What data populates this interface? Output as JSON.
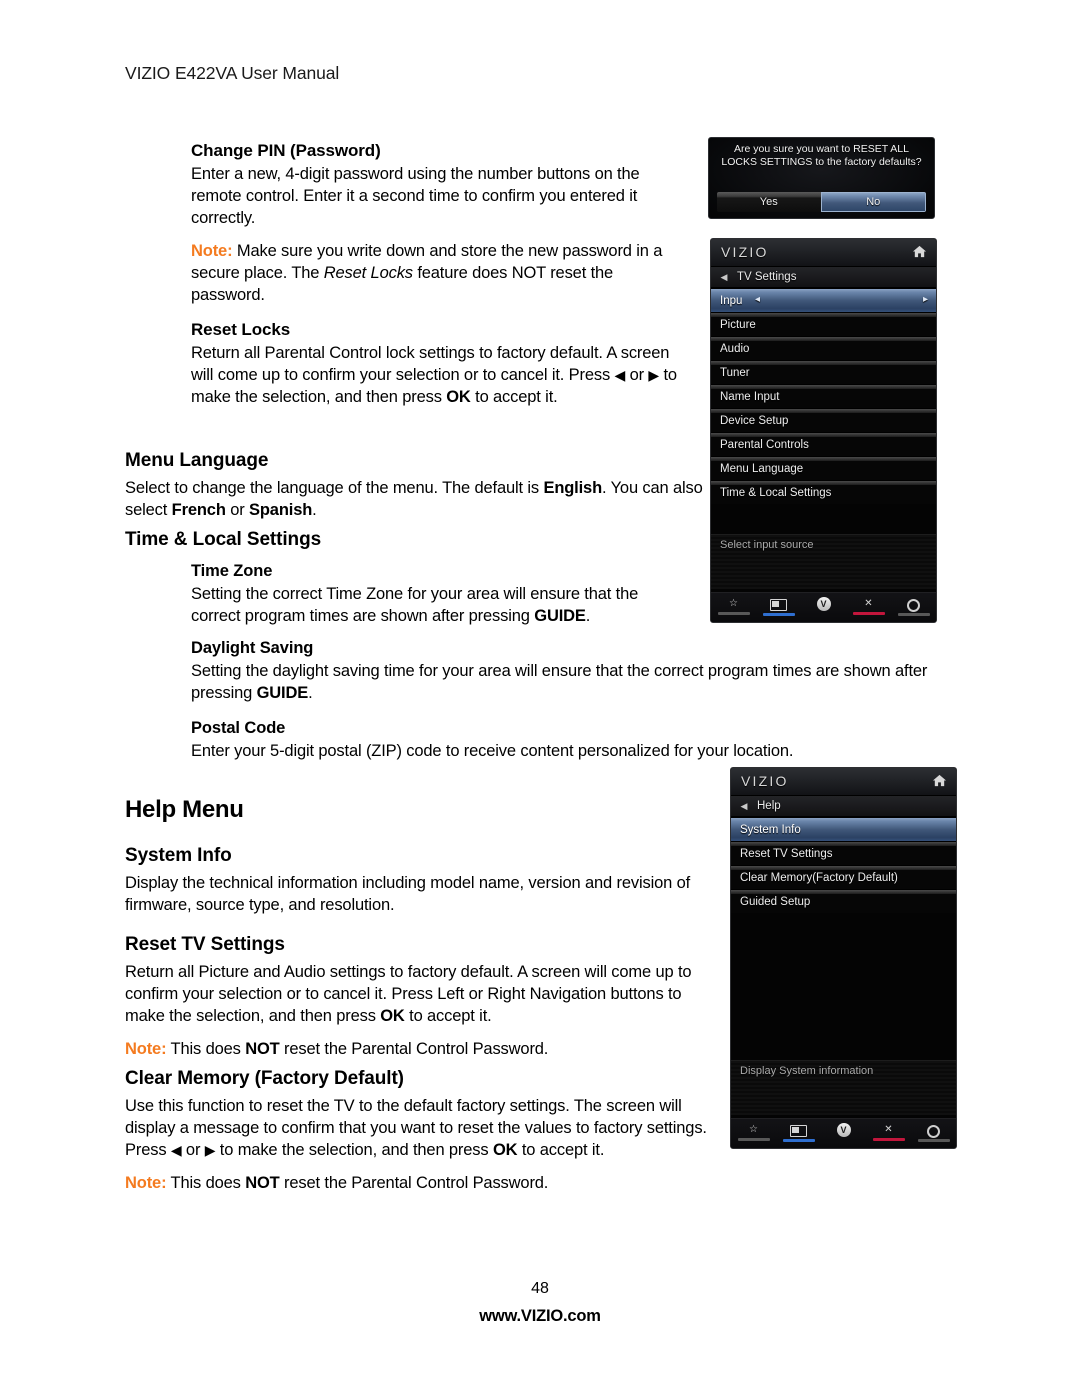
{
  "page": {
    "header": "VIZIO E422VA User Manual",
    "number": "48",
    "url": "www.VIZIO.com"
  },
  "sections": {
    "change_pin": {
      "heading": "Change PIN (Password)",
      "para1": "Enter a new, 4-digit password using the number buttons on the remote control. Enter it a second time to confirm you entered it correctly.",
      "note_label": "Note:",
      "note_a": " Make sure you write down and store the new password in a secure place. The ",
      "note_italic": "Reset Locks",
      "note_b": " feature does NOT reset the password."
    },
    "reset_locks": {
      "heading": "Reset Locks",
      "para_a": "Return all Parental Control lock settings to factory default. A screen will come up to confirm your selection or to cancel it. Press ",
      "arrow_left": "◀",
      "para_b": " or ",
      "arrow_right": "▶",
      "para_c": " to make the selection, and then press ",
      "ok": "OK",
      "para_d": " to accept it."
    },
    "menu_language": {
      "heading": "Menu Language",
      "para_a": "Select to change the language of the menu. The default is ",
      "default_lang": "English",
      "para_b": ". You can also select ",
      "lang2": "French",
      "para_c": " or ",
      "lang3": "Spanish",
      "para_d": "."
    },
    "time_local": {
      "heading": "Time & Local Settings",
      "time_zone": {
        "heading": "Time Zone",
        "para_a": "Setting the correct Time Zone for your area will ensure that the correct program times are shown after pressing ",
        "guide": "GUIDE",
        "para_b": "."
      },
      "daylight": {
        "heading": "Daylight Saving",
        "para_a": "Setting the daylight saving time for your area will ensure that the correct program times are shown after pressing ",
        "guide": "GUIDE",
        "para_b": "."
      },
      "postal": {
        "heading": "Postal Code",
        "para": "Enter your 5-digit postal (ZIP) code to receive content personalized for your location."
      }
    },
    "help_menu": {
      "heading": "Help Menu",
      "system_info": {
        "heading": "System Info",
        "para": "Display the technical information including model name, version and revision of firmware, source type, and resolution."
      },
      "reset_tv": {
        "heading": "Reset TV Settings",
        "para_a": "Return all Picture and Audio settings to factory default. A screen will come up to confirm your selection or to cancel it. Press Left or Right Navigation buttons to make the selection, and then press ",
        "ok": "OK",
        "para_b": " to accept it.",
        "note_label": "Note:",
        "note_a": " This does ",
        "note_not": "NOT",
        "note_b": " reset the Parental Control Password."
      },
      "clear_memory": {
        "heading": "Clear Memory (Factory Default)",
        "para_a": "Use this function to reset the TV to the default factory settings. The screen will display a message to confirm that you want to reset the values to factory settings. Press ",
        "arrow_left": "◀",
        "para_b": " or ",
        "arrow_right": "▶",
        "para_c": " to make the selection, and then press ",
        "ok": "OK",
        "para_d": " to accept it.",
        "note_label": "Note:",
        "note_a": " This does ",
        "note_not": "NOT",
        "note_b": " reset the Parental Control Password."
      }
    }
  },
  "osd": {
    "confirm_dialog": {
      "message": "Are you sure you want to RESET ALL LOCKS SETTINGS to the factory defaults?",
      "yes_label": "Yes",
      "no_label": "No",
      "selected": "No",
      "selected_color": "#41587a"
    },
    "tv_settings_menu": {
      "brand": "VIZIO",
      "home_icon": "home-icon",
      "back_icon": "back-arrow-icon",
      "breadcrumb": "TV Settings",
      "items": [
        {
          "label": "Inpu",
          "selected": true,
          "left_chevron": "◂",
          "right_chevron": "▸"
        },
        {
          "label": "Picture",
          "selected": false
        },
        {
          "label": "Audio",
          "selected": false
        },
        {
          "label": "Tuner",
          "selected": false
        },
        {
          "label": "Name Input",
          "selected": false
        },
        {
          "label": "Device Setup",
          "selected": false
        },
        {
          "label": "Parental Controls",
          "selected": false
        },
        {
          "label": "Menu Language",
          "selected": false
        },
        {
          "label": "Time & Local Settings",
          "selected": false
        }
      ],
      "hint": "Select input source",
      "footer": [
        {
          "icon": "star-icon",
          "glyph": "☆",
          "bar": "grey"
        },
        {
          "icon": "tv-icon",
          "glyph": "",
          "bar": "blue"
        },
        {
          "icon": "vizio-v-icon",
          "glyph": "V",
          "bar": "none"
        },
        {
          "icon": "close-x-icon",
          "glyph": "✕",
          "bar": "red"
        },
        {
          "icon": "gear-icon",
          "glyph": "",
          "bar": "grey"
        }
      ]
    },
    "help_menu": {
      "brand": "VIZIO",
      "home_icon": "home-icon",
      "back_icon": "back-arrow-icon",
      "breadcrumb": "Help",
      "items": [
        {
          "label": "System Info",
          "selected": true
        },
        {
          "label": "Reset TV Settings",
          "selected": false
        },
        {
          "label": "Clear Memory(Factory Default)",
          "selected": false
        },
        {
          "label": "Guided Setup",
          "selected": false
        }
      ],
      "hint": "Display System information",
      "footer": [
        {
          "icon": "star-icon",
          "glyph": "☆",
          "bar": "grey"
        },
        {
          "icon": "tv-icon",
          "glyph": "",
          "bar": "blue"
        },
        {
          "icon": "vizio-v-icon",
          "glyph": "V",
          "bar": "none"
        },
        {
          "icon": "close-x-icon",
          "glyph": "✕",
          "bar": "red"
        },
        {
          "icon": "gear-icon",
          "glyph": "",
          "bar": "grey"
        }
      ]
    }
  }
}
